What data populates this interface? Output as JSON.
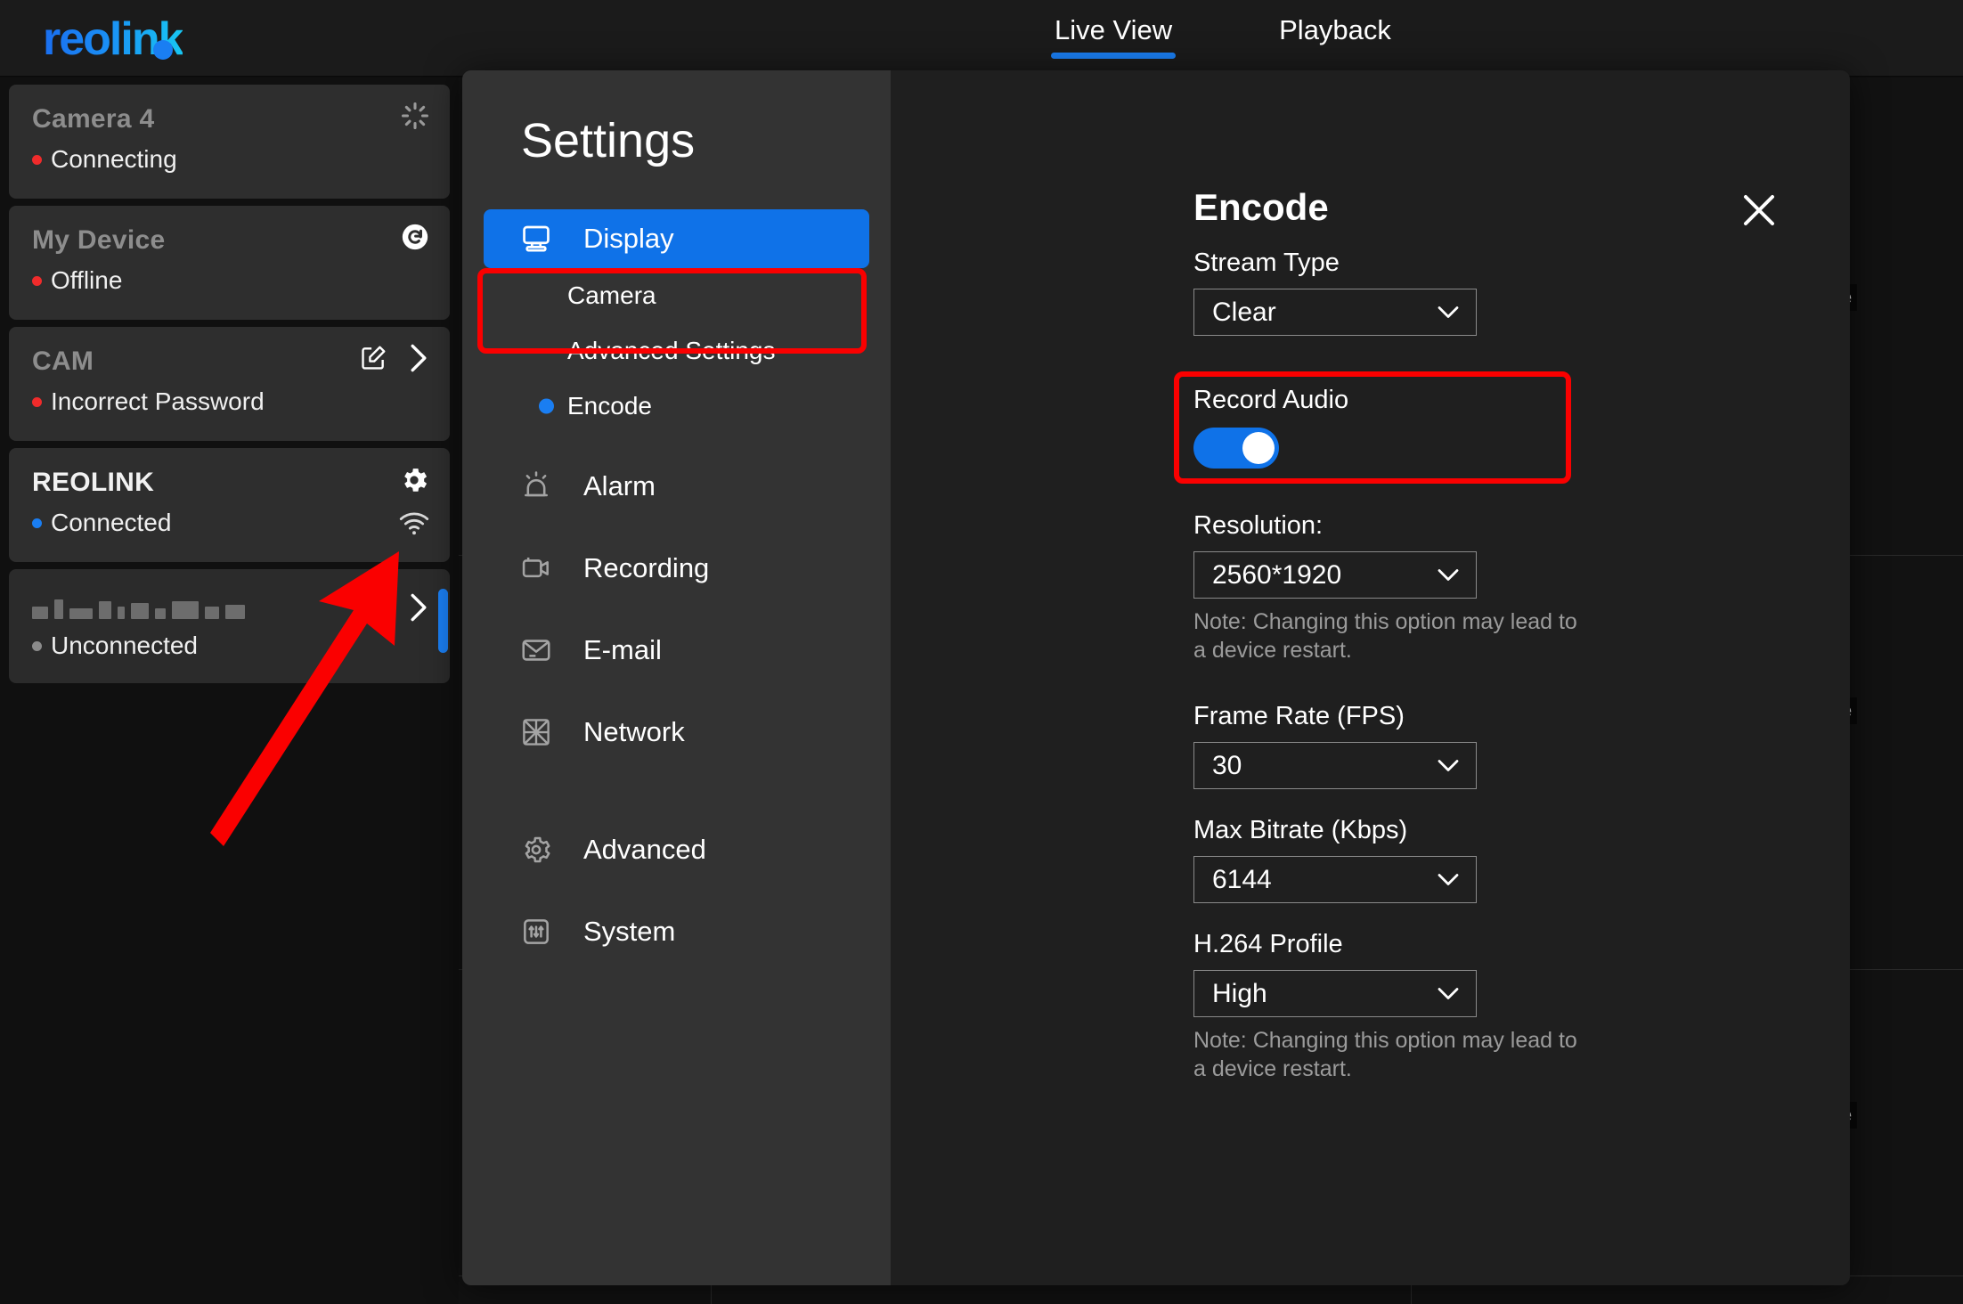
{
  "app": {
    "logo_text": "reolink"
  },
  "tabs": [
    {
      "label": "Live View",
      "active": true
    },
    {
      "label": "Playback",
      "active": false
    }
  ],
  "background": {
    "tile_labels": [
      "ere",
      "ere",
      "ere"
    ]
  },
  "sidebar": {
    "devices": [
      {
        "name": "Camera 4",
        "status": "Connecting",
        "status_color": "#f02b2b",
        "name_dim": true,
        "icons": [
          "spinner-icon"
        ]
      },
      {
        "name": "My Device",
        "status": "Offline",
        "status_color": "#f02b2b",
        "name_dim": true,
        "icons": [
          "refresh-icon"
        ]
      },
      {
        "name": "CAM",
        "status": "Incorrect Password",
        "status_color": "#f02b2b",
        "name_dim": true,
        "icons": [
          "edit-icon",
          "chevron-right-icon"
        ]
      },
      {
        "name": "REOLINK",
        "status": "Connected",
        "status_color": "#1a7ef2",
        "name_dim": false,
        "icons": [
          "gear-icon",
          "wifi-icon"
        ]
      },
      {
        "name": "",
        "status": "Unconnected",
        "status_color": "#8b8b8b",
        "name_dim": true,
        "icons": [
          "refresh-icon",
          "chevron-right-icon"
        ],
        "redacted": true
      }
    ]
  },
  "modal": {
    "title": "Settings",
    "close_label": "close-icon",
    "nav": {
      "display": {
        "label": "Display",
        "icon": "monitor-icon",
        "active": true,
        "highlighted": true
      },
      "sub_items": [
        {
          "label": "Camera",
          "selected": false
        },
        {
          "label": "Advanced Settings",
          "selected": false
        },
        {
          "label": "Encode",
          "selected": true
        }
      ],
      "items": [
        {
          "label": "Alarm",
          "icon": "alarm-icon"
        },
        {
          "label": "Recording",
          "icon": "video-camera-icon"
        },
        {
          "label": "E-mail",
          "icon": "envelope-icon"
        },
        {
          "label": "Network",
          "icon": "network-icon"
        },
        {
          "label": "Advanced",
          "icon": "gear-icon"
        },
        {
          "label": "System",
          "icon": "system-icon"
        }
      ]
    },
    "encode": {
      "heading": "Encode",
      "stream_type_label": "Stream Type",
      "stream_type_value": "Clear",
      "record_audio_label": "Record Audio",
      "record_audio_on": true,
      "resolution_label": "Resolution:",
      "resolution_value": "2560*1920",
      "resolution_note": "Note: Changing this option may lead to a device restart.",
      "frame_rate_label": "Frame Rate (FPS)",
      "frame_rate_value": "30",
      "max_bitrate_label": "Max Bitrate (Kbps)",
      "max_bitrate_value": "6144",
      "h264_label": "H.264 Profile",
      "h264_value": "High",
      "h264_note": "Note: Changing this option may lead to a device restart."
    }
  },
  "annotations": {
    "arrow_color": "#fa0000",
    "highlight_color": "#fa0000",
    "accent_color": "#1a7ef2"
  }
}
